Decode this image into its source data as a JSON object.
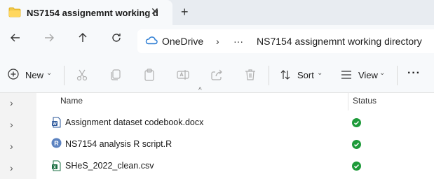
{
  "tab": {
    "title": "NS7154 assignemnt working d"
  },
  "address": {
    "root": "OneDrive",
    "more": "···",
    "folder": "NS7154 assignemnt working directory"
  },
  "toolbar": {
    "new_label": "New",
    "sort_label": "Sort",
    "view_label": "View",
    "more_label": "···"
  },
  "columns": {
    "name": "Name",
    "status": "Status"
  },
  "files": [
    {
      "name": "Assignment dataset codebook.docx",
      "type_icon": "word-document-icon",
      "status_icon": "synced-check-icon"
    },
    {
      "name": "NS7154 analysis R script.R",
      "type_icon": "r-script-icon",
      "status_icon": "synced-check-icon"
    },
    {
      "name": "SHeS_2022_clean.csv",
      "type_icon": "excel-csv-icon",
      "status_icon": "synced-check-icon"
    }
  ],
  "colors": {
    "folder": "#f2c94c",
    "onedrive": "#2b7cd3",
    "status_ok": "#1e9b3a",
    "word": "#2b579a",
    "excel": "#1d7044",
    "r": "#5b82c0"
  }
}
